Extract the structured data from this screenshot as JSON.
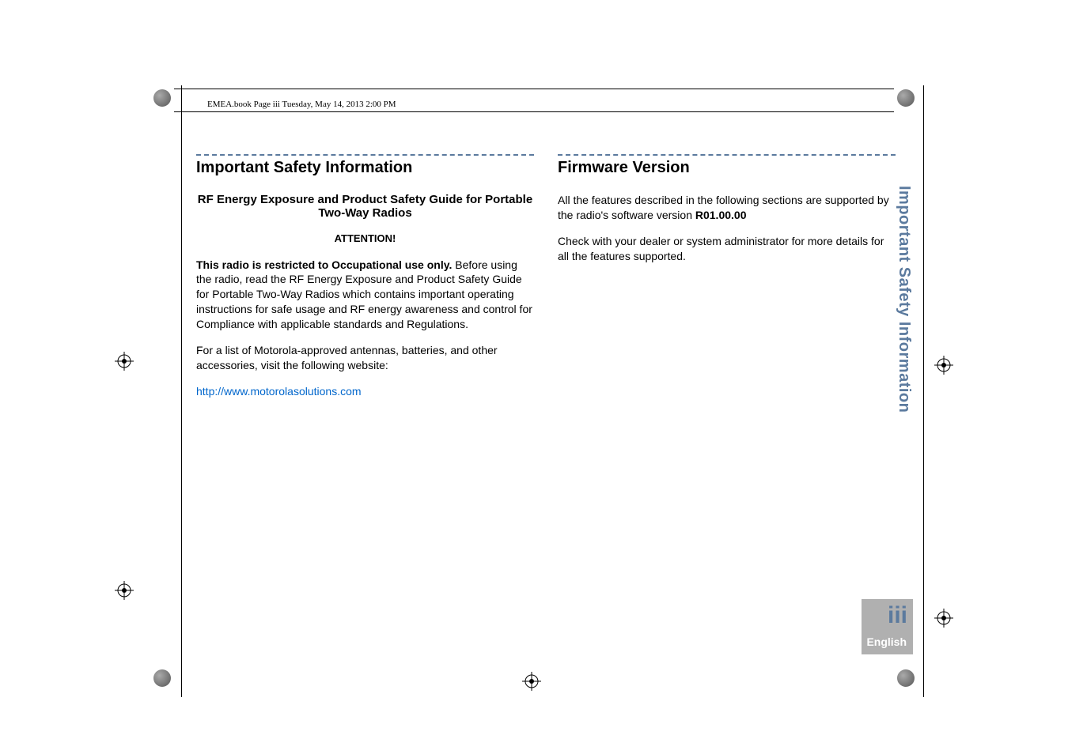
{
  "header": {
    "text": "EMEA.book  Page iii  Tuesday, May 14, 2013  2:00 PM"
  },
  "left_column": {
    "title": "Important Safety Information",
    "subtitle": "RF Energy Exposure and Product Safety Guide for Portable Two-Way Radios",
    "attention": "ATTENTION!",
    "bold_intro": "This radio is restricted to Occupational use only.",
    "paragraph1": " Before using the radio, read the RF Energy Exposure and Product Safety Guide for Portable Two-Way Radios which contains important operating instructions for safe usage and RF energy awareness and control for Compliance with applicable standards and Regulations.",
    "paragraph2": "For a list of Motorola-approved antennas, batteries, and other accessories, visit the following website:",
    "link": "http://www.motorolasolutions.com"
  },
  "right_column": {
    "title": "Firmware Version",
    "paragraph1_part1": "All the features described in the following sections are supported by the radio's software version ",
    "version": "R01.00.00",
    "paragraph2": "Check with your dealer or system administrator for more details for all the features supported."
  },
  "side_tab": {
    "text": "Important Safety Information"
  },
  "footer": {
    "page_number": "iii",
    "language": "English"
  }
}
